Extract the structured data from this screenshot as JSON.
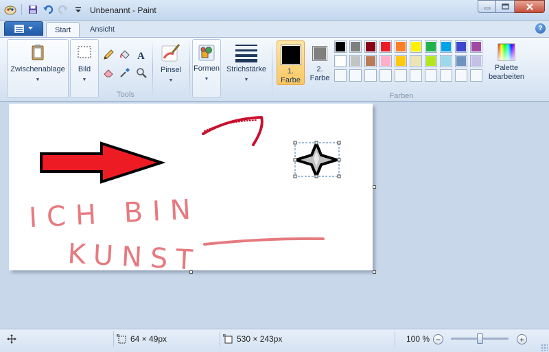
{
  "window": {
    "title": "Unbenannt - Paint"
  },
  "tabs": [
    {
      "label": "Start"
    },
    {
      "label": "Ansicht"
    }
  ],
  "ribbon": {
    "clipboard_label": "Zwischenablage",
    "image_label": "Bild",
    "tools_label": "Tools",
    "brushes_label": "Pinsel",
    "shapes_label": "Formen",
    "size_label": "Strichstärke",
    "color1_label_line1": "1.",
    "color1_label_line2": "Farbe",
    "color2_label_line1": "2.",
    "color2_label_line2": "Farbe",
    "colors_group_label": "Farben",
    "edit_colors_line1": "Palette",
    "edit_colors_line2": "bearbeiten",
    "color1_value": "#000000",
    "color2_value": "#7f7f7f",
    "palette_row1": [
      "#000000",
      "#7f7f7f",
      "#880015",
      "#ed1c24",
      "#ff7f27",
      "#fff200",
      "#22b14c",
      "#00a2e8",
      "#3f48cc",
      "#a349a4"
    ],
    "palette_row2": [
      "#ffffff",
      "#c3c3c3",
      "#b97a57",
      "#ffaec9",
      "#ffc90e",
      "#efe4b0",
      "#b5e61d",
      "#99d9ea",
      "#7092be",
      "#c8bfe7"
    ]
  },
  "canvas_text": {
    "line1": "ICH BIN",
    "line2": "KUNST"
  },
  "statusbar": {
    "selection_size": "64 × 49px",
    "canvas_size": "530 × 243px",
    "zoom": "100 %"
  },
  "icons": {
    "move": "move-icon",
    "selection": "selection-size-icon",
    "canvas": "canvas-size-icon",
    "zoom_out": "zoom-out-icon",
    "zoom_in": "zoom-in-icon"
  }
}
